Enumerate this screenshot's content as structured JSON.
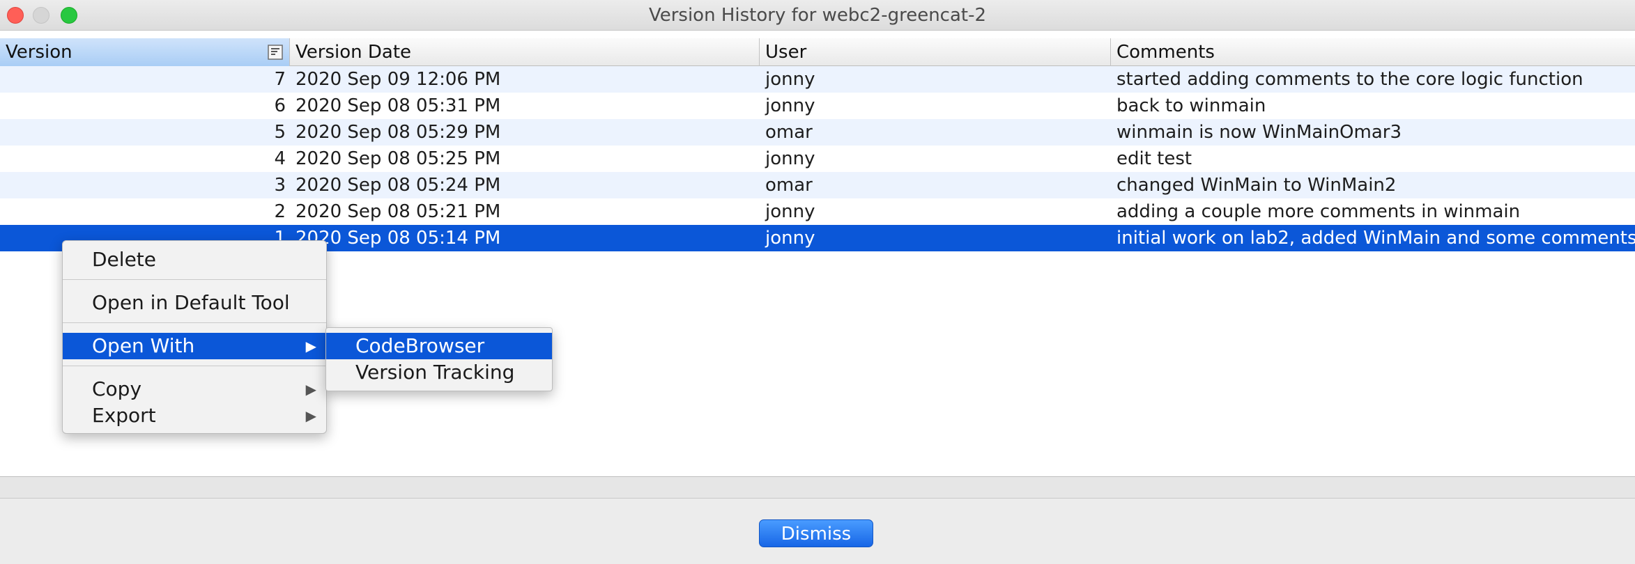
{
  "window": {
    "title": "Version History for webc2-greencat-2"
  },
  "table": {
    "columns": [
      "Version",
      "Version Date",
      "User",
      "Comments"
    ],
    "rows": [
      {
        "version": "7",
        "date": "2020 Sep 09 12:06 PM",
        "user": "jonny",
        "comment": "started adding comments to the core logic function"
      },
      {
        "version": "6",
        "date": "2020 Sep 08 05:31 PM",
        "user": "jonny",
        "comment": "back to winmain"
      },
      {
        "version": "5",
        "date": "2020 Sep 08 05:29 PM",
        "user": "omar",
        "comment": "winmain is now WinMainOmar3"
      },
      {
        "version": "4",
        "date": "2020 Sep 08 05:25 PM",
        "user": "jonny",
        "comment": "edit test"
      },
      {
        "version": "3",
        "date": "2020 Sep 08 05:24 PM",
        "user": "omar",
        "comment": "changed WinMain to WinMain2"
      },
      {
        "version": "2",
        "date": "2020 Sep 08 05:21 PM",
        "user": "jonny",
        "comment": "adding a couple more comments in winmain"
      },
      {
        "version": "1",
        "date": "2020 Sep 08 05:14 PM",
        "user": "jonny",
        "comment": "initial work on lab2, added WinMain and some comments"
      }
    ],
    "selected_version": "1"
  },
  "context_menu": {
    "items": [
      "Delete",
      "Open in Default Tool",
      "Open With",
      "Copy",
      "Export"
    ],
    "active": "Open With",
    "submenu_arrow": "▶"
  },
  "submenu": {
    "items": [
      "CodeBrowser",
      "Version Tracking"
    ],
    "active": "CodeBrowser"
  },
  "footer": {
    "dismiss_label": "Dismiss"
  },
  "colors": {
    "selection": "#0b57d8",
    "alt_row": "#ecf3fe",
    "button": "#1766e6"
  },
  "icons": {
    "filter": "filter-icon",
    "close": "close-window-icon",
    "minimize": "minimize-window-icon",
    "zoom": "zoom-window-icon"
  }
}
